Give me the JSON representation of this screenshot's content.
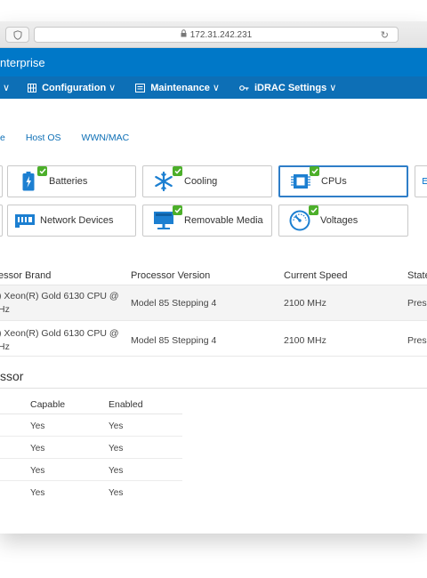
{
  "browser": {
    "url": "172.31.242.231"
  },
  "brand": {
    "title": "nterprise"
  },
  "nav": {
    "items": [
      {
        "label": ""
      },
      {
        "label": "Configuration"
      },
      {
        "label": "Maintenance"
      },
      {
        "label": "iDRAC Settings"
      }
    ]
  },
  "tabs": [
    "e",
    "Host OS",
    "WWN/MAC"
  ],
  "tiles": [
    {
      "label": "Batteries",
      "icon": "battery-icon"
    },
    {
      "label": "Cooling",
      "icon": "fan-icon"
    },
    {
      "label": "CPUs",
      "icon": "cpu-icon",
      "selected": true
    },
    {
      "label": "Network Devices",
      "icon": "network-card-icon"
    },
    {
      "label": "Removable Media",
      "icon": "removable-media-icon"
    },
    {
      "label": "Voltages",
      "icon": "gauge-icon"
    }
  ],
  "processor_table": {
    "headers": [
      "essor Brand",
      "Processor Version",
      "Current Speed",
      "State"
    ],
    "rows": [
      {
        "brand_line1": ") Xeon(R) Gold 6130 CPU @",
        "brand_line2": "Hz",
        "version": "Model 85 Stepping 4",
        "speed": "2100 MHz",
        "state": "Prese"
      },
      {
        "brand_line1": ") Xeon(R) Gold 6130 CPU @",
        "brand_line2": "Hz",
        "version": "Model 85 Stepping 4",
        "speed": "2100 MHz",
        "state": "Prese"
      }
    ]
  },
  "capabilities": {
    "title": "ssor",
    "headers": [
      "Capable",
      "Enabled"
    ],
    "rows": [
      {
        "capable": "Yes",
        "enabled": "Yes"
      },
      {
        "capable": "Yes",
        "enabled": "Yes"
      },
      {
        "capable": "Yes",
        "enabled": "Yes"
      },
      {
        "capable": "Yes",
        "enabled": "Yes"
      }
    ]
  },
  "colors": {
    "brand_bar": "#0078c8",
    "nav_bar": "#0d6fb6",
    "status_ok": "#4caf2a",
    "selected_border": "#2f7ec8"
  }
}
